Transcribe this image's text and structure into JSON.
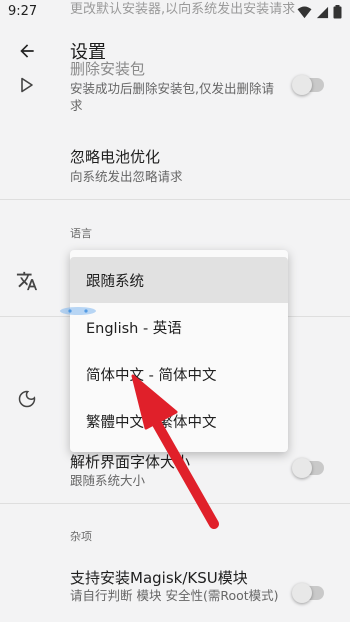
{
  "status": {
    "time": "9:27"
  },
  "appbar": {
    "title": "设置"
  },
  "ghost_line": "更改默认安装器,以向系统发出安装请求",
  "uninstall_row": {
    "title": "删除安装包",
    "subtitle": "安装成功后删除安装包,仅发出删除请求"
  },
  "battery_row": {
    "title": "忽略电池优化",
    "subtitle": "向系统发出忽略请求"
  },
  "language_section": {
    "header": "语言"
  },
  "language_dropdown": {
    "options": [
      "跟随系统",
      "English - 英语",
      "简体中文 - 简体中文",
      "繁體中文 - 繁体中文"
    ],
    "selected": "跟随系统"
  },
  "font_row": {
    "title": "解析界面字体大小",
    "subtitle": "跟随系统大小"
  },
  "misc_section": {
    "header": "杂项"
  },
  "magisk_row": {
    "title": "支持安装Magisk/KSU模块",
    "subtitle": "请自行判断 模块 安全性(需Root模式)"
  },
  "accent": {
    "arrow": "#e0202a",
    "switch_off": "#c9c9c9"
  }
}
